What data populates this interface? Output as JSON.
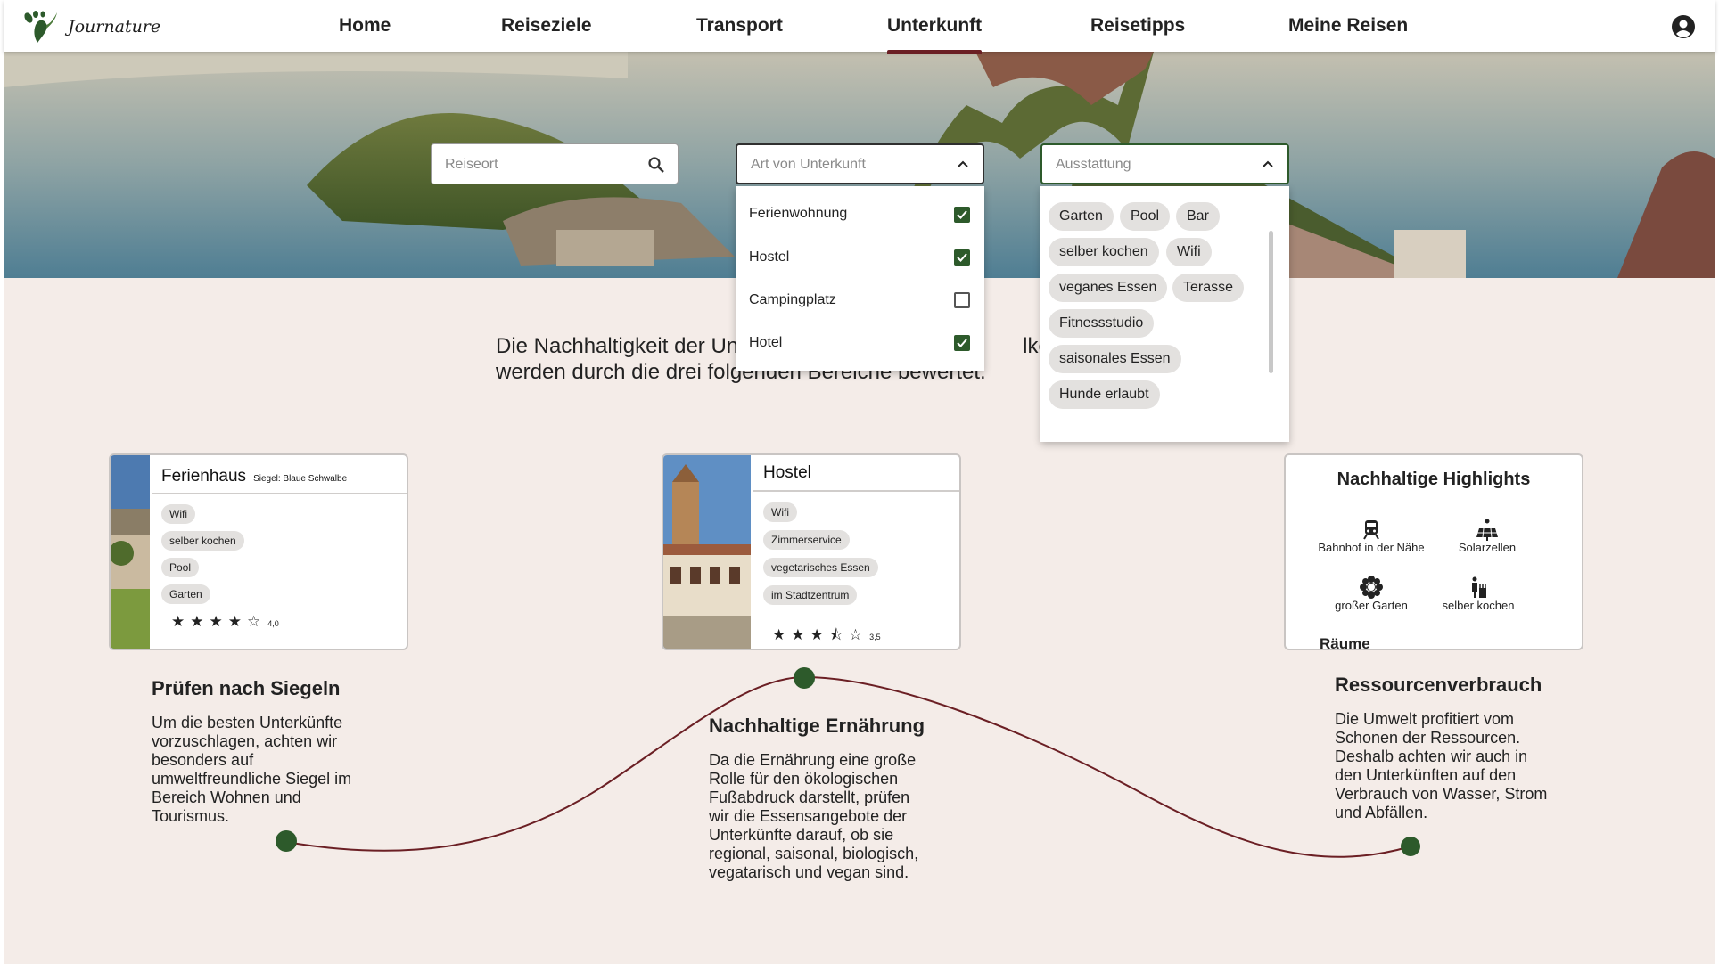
{
  "brand": {
    "name": "Journature"
  },
  "nav": {
    "items": [
      {
        "label": "Home",
        "active": false
      },
      {
        "label": "Reiseziele",
        "active": false
      },
      {
        "label": "Transport",
        "active": false
      },
      {
        "label": "Unterkunft",
        "active": true
      },
      {
        "label": "Reisetipps",
        "active": false
      },
      {
        "label": "Meine Reisen",
        "active": false
      }
    ],
    "profile_icon": "account-circle-icon"
  },
  "search": {
    "reiseort_placeholder": "Reiseort",
    "unterkunft_placeholder": "Art von Unterkunft",
    "ausstattung_placeholder": "Ausstattung"
  },
  "unterkunft_options": [
    {
      "label": "Ferienwohnung",
      "checked": true
    },
    {
      "label": "Hostel",
      "checked": true
    },
    {
      "label": "Campingplatz",
      "checked": false
    },
    {
      "label": "Hotel",
      "checked": true
    }
  ],
  "ausstattung_chips": [
    "Garten",
    "Pool",
    "Bar",
    "selber kochen",
    "Wifi",
    "veganes Essen",
    "Terasse",
    "Fitnessstudio",
    "saisonales Essen",
    "Hunde erlaubt"
  ],
  "intro": {
    "line1_start": "Die Nachhaltigkeit der Un",
    "line1_end": "lken c",
    "line2": "werden durch die drei folgenden Bereiche bewertet."
  },
  "cards": {
    "ferienhaus": {
      "title": "Ferienhaus",
      "siegel": "Siegel: Blaue Schwalbe",
      "tags": [
        "Wifi",
        "selber kochen",
        "Pool",
        "Garten"
      ],
      "stars": "★★★★☆",
      "rating": "4,0"
    },
    "hostel": {
      "title": "Hostel",
      "tags": [
        "Wifi",
        "Zimmerservice",
        "vegetarisches Essen",
        "im Stadtzentrum"
      ],
      "stars": "★★★⯪☆",
      "rating": "3,5"
    },
    "highlights": {
      "title": "Nachhaltige Highlights",
      "items": [
        {
          "label": "Bahnhof in der Nähe",
          "icon": "train-icon"
        },
        {
          "label": "Solarzellen",
          "icon": "solar-panel-icon"
        },
        {
          "label": "großer Garten",
          "icon": "flower-icon"
        },
        {
          "label": "selber kochen",
          "icon": "cooking-icon"
        }
      ],
      "cut_text": "Räume"
    }
  },
  "sections": [
    {
      "title": "Prüfen nach Siegeln",
      "body": "Um die besten Unterkünfte vorzuschlagen, achten wir besonders auf umweltfreundliche Siegel im Bereich Wohnen und Tourismus."
    },
    {
      "title": "Nachhaltige Ernährung",
      "body": "Da die Ernährung eine große Rolle für den ökologischen Fußabdruck darstellt, prüfen wir die Essensangebote der Unterkünfte darauf, ob sie regional, saisonal, biologisch, vegatarisch und vegan sind."
    },
    {
      "title": "Ressourcenverbrauch",
      "body": "Die Umwelt profitiert vom Schonen der Ressourcen. Deshalb achten wir auch in den Unterkünften auf den Verbrauch von Wasser, Strom und Abfällen."
    }
  ],
  "colors": {
    "accent_green": "#2d5a2b",
    "accent_maroon": "#6b1f24",
    "background": "#f4ece8"
  }
}
